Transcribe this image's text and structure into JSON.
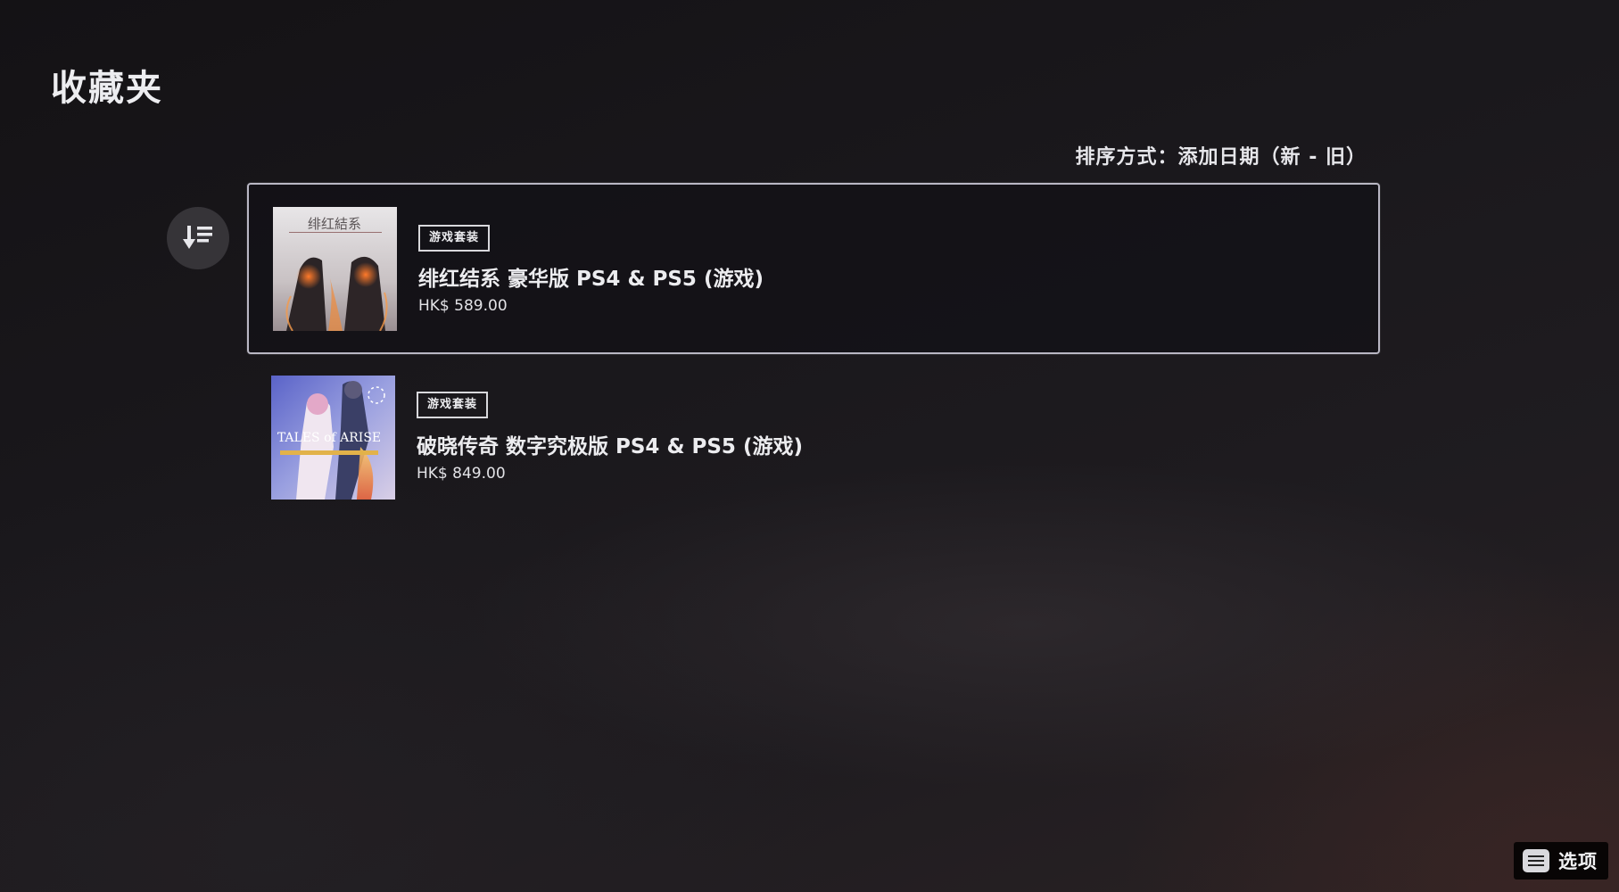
{
  "page": {
    "title": "收藏夹",
    "sort_label": "排序方式：添加日期（新 - 旧）"
  },
  "sort_button": {
    "icon": "sort-descending-icon"
  },
  "items": [
    {
      "badge": "游戏套装",
      "title": "绯红结系 豪华版 PS4 & PS5 (游戏)",
      "price": "HK$ 589.00",
      "selected": true,
      "cover_text": "绯红結系"
    },
    {
      "badge": "游戏套装",
      "title": "破晓传奇 数字究极版 PS4 & PS5 (游戏)",
      "price": "HK$ 849.00",
      "selected": false,
      "cover_text": "TALES of ARISE"
    }
  ],
  "footer": {
    "options_icon": "options-menu-icon",
    "options_label": "选项"
  },
  "colors": {
    "background": "#1a181c",
    "selection_border": "#b9b7c4",
    "text": "#e9e9ec"
  }
}
